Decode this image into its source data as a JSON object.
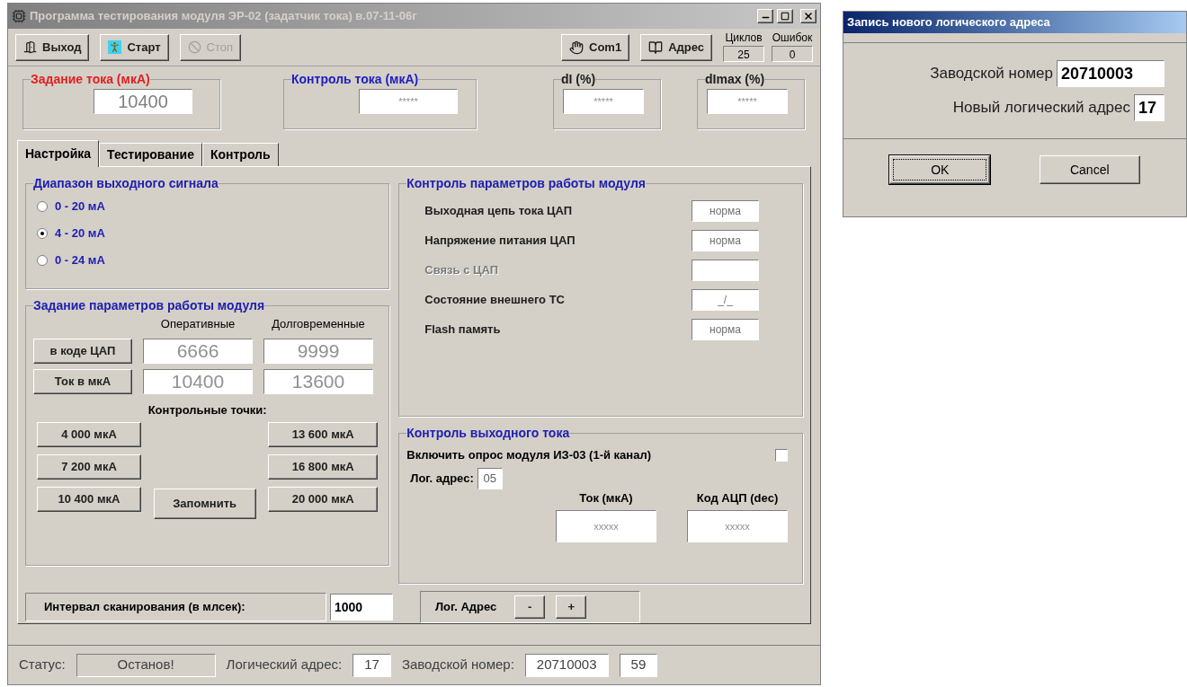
{
  "window": {
    "title": "Программа тестирования модуля ЭР-02 (задатчик тока) в.07-11-06г"
  },
  "toolbar": {
    "buttons": [
      {
        "label": "Выход",
        "kind": "exit",
        "disabled": false
      },
      {
        "label": "Старт",
        "kind": "start",
        "disabled": false
      },
      {
        "label": "Стоп",
        "kind": "stop",
        "disabled": true
      },
      {
        "label": "Com1",
        "kind": "port",
        "disabled": false
      },
      {
        "label": "Адрес",
        "kind": "address",
        "disabled": false
      }
    ],
    "counters": [
      {
        "label": "Циклов",
        "value": "25"
      },
      {
        "label": "Ошибок",
        "value": "0"
      }
    ]
  },
  "indicators": [
    {
      "title": "Задание тока (мкА)",
      "value": "10400",
      "color": "#e02020"
    },
    {
      "title": "Контроль тока (мкА)",
      "value": "*****",
      "color": "#2020c0"
    },
    {
      "title": "dI (%)",
      "value": "*****",
      "color": "#202020"
    },
    {
      "title": "dImax (%)",
      "value": "*****",
      "color": "#202020"
    }
  ],
  "tabs": [
    {
      "label": "Настройка",
      "selected": true
    },
    {
      "label": "Тестирование",
      "selected": false
    },
    {
      "label": "Контроль",
      "selected": false
    }
  ],
  "range_group": {
    "title": "Диапазон выходного сигнала",
    "options": [
      {
        "label": "0 - 20 мА",
        "selected": false
      },
      {
        "label": "4 - 20 мА",
        "selected": true
      },
      {
        "label": "0 - 24 мА",
        "selected": false
      }
    ]
  },
  "params_group": {
    "title": "Задание параметров  работы модуля",
    "columns": [
      "Оперативные",
      "Долговременные"
    ],
    "rows": [
      {
        "button": "в коде ЦАП",
        "values": [
          "6666",
          "9999"
        ]
      },
      {
        "button": "Ток в мкА",
        "values": [
          "10400",
          "13600"
        ]
      }
    ],
    "checkpoints_label": "Контрольные точки:",
    "checkpoints_left": [
      "4 000 мкА",
      "7 200 мкА",
      "10 400 мкА"
    ],
    "checkpoints_right": [
      "13 600 мкА",
      "16 800 мкА",
      "20 000 мкА"
    ],
    "save_button": "Запомнить"
  },
  "control_group": {
    "title": "Контроль параметров  работы модуля",
    "rows": [
      {
        "label": "Выходная цепь тока ЦАП",
        "value": "норма",
        "disabled": false
      },
      {
        "label": "Напряжение питания ЦАП",
        "value": "норма",
        "disabled": false
      },
      {
        "label": "Связь с ЦАП",
        "disabled": true
      },
      {
        "label": "Состояние внешнего ТС",
        "value": "_/_",
        "disabled": false
      },
      {
        "label": "Flash память",
        "value": "норма",
        "disabled": false
      }
    ]
  },
  "output_group": {
    "title": "Контроль выходного тока",
    "poll_label": "Включить опрос модуля ИЗ-03 (1-й канал)",
    "poll_checked": false,
    "address_label": "Лог. адрес:",
    "address_value": "05",
    "columns": [
      {
        "label": "Ток (мкА)",
        "value": "xxxxx"
      },
      {
        "label": "Код АЦП (dec)",
        "value": "xxxxx"
      }
    ]
  },
  "interval": {
    "label": "Интервал сканирования (в млсек):",
    "value": "1000"
  },
  "log_address": {
    "label": "Лог. Адрес",
    "buttons": [
      "-",
      "+"
    ]
  },
  "status_bar": [
    {
      "label": "Статус:",
      "value": "Останов!"
    },
    {
      "label": "Логический адрес:",
      "value": "17"
    },
    {
      "label": "Заводской номер:",
      "value": "20710003"
    },
    {
      "value": "59"
    }
  ],
  "dialog": {
    "title": "Запись нового логического адреса",
    "fields": [
      {
        "label": "Заводской номер",
        "value": "20710003"
      },
      {
        "label": "Новый логический адрес",
        "value": "17"
      }
    ],
    "buttons": [
      {
        "label": "OK",
        "default": true
      },
      {
        "label": "Cancel",
        "default": false
      }
    ]
  }
}
